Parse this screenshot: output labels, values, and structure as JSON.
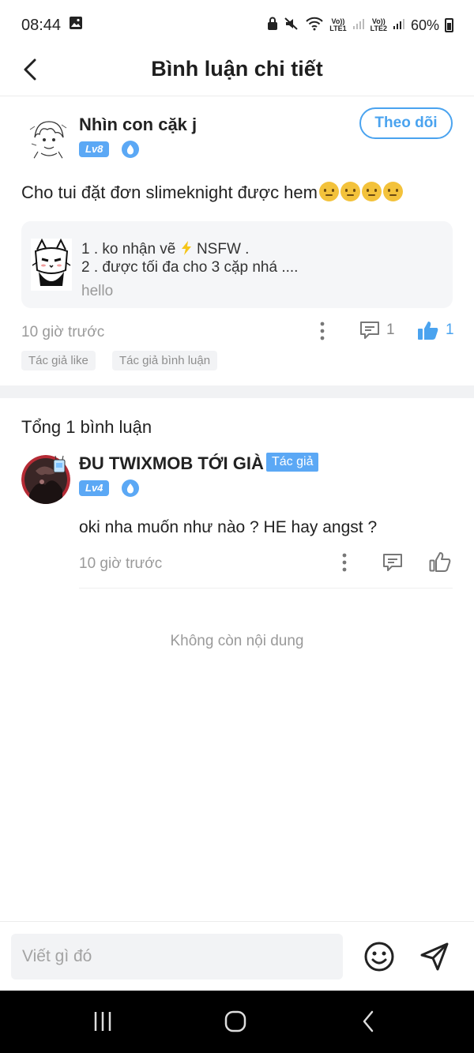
{
  "status_bar": {
    "time": "08:44",
    "sim1": "LTE1",
    "sim2": "LTE2",
    "volte": "Vo))",
    "battery": "60%"
  },
  "header": {
    "title": "Bình luận chi tiết",
    "back_icon": "chevron-left-icon"
  },
  "post": {
    "username": "Nhìn con cặk j",
    "level": "Lv8",
    "follow_label": "Theo dõi",
    "text": "Cho tui đặt đơn slimeknight được hem",
    "emoji_count": 4,
    "quote": {
      "line1_a": "1 . ko nhận vẽ",
      "line1_b": "NSFW .",
      "line2": "2 . được tối đa cho 3 cặp nhá ....",
      "sub": "hello"
    },
    "time": "10 giờ trước",
    "comment_count": "1",
    "like_count": "1",
    "tags": [
      "Tác giả like",
      "Tác giả bình luận"
    ]
  },
  "comments": {
    "total_label": "Tổng 1 bình luận",
    "items": [
      {
        "username": "ĐU TWIXMOB TỚI GIÀ",
        "author_tag": "Tác giả",
        "level": "Lv4",
        "text": "oki nha muốn như nào ? HE hay angst ?",
        "time": "10 giờ trước"
      }
    ],
    "end_label": "Không còn nội dung"
  },
  "input_bar": {
    "placeholder": "Viết gì đó",
    "emoji_icon": "smiley-icon",
    "send_icon": "send-icon"
  },
  "colors": {
    "accent": "#4aa3ef",
    "badge": "#5ba8f5",
    "muted": "#9a9a9a"
  }
}
